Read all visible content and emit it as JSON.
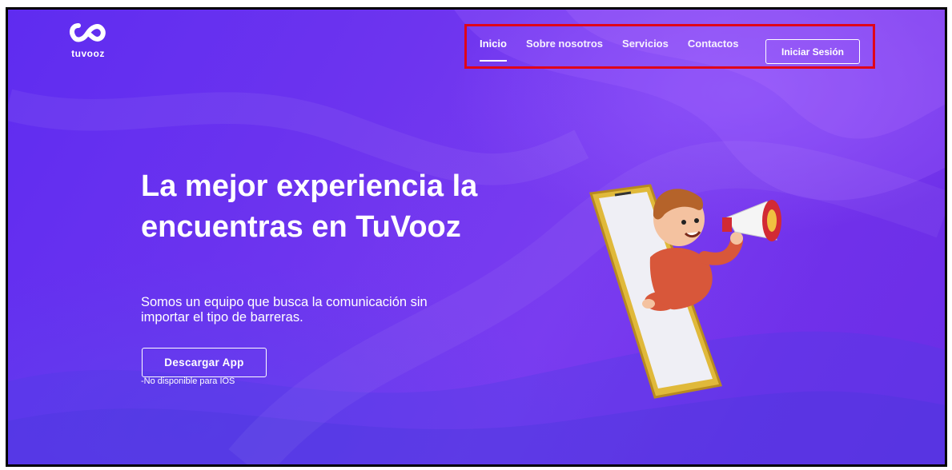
{
  "brand": {
    "name": "tuvooz",
    "logo_icon": "infinity-icon"
  },
  "nav": {
    "items": [
      {
        "label": "Inicio",
        "active": true
      },
      {
        "label": "Sobre nosotros",
        "active": false
      },
      {
        "label": "Servicios",
        "active": false
      },
      {
        "label": "Contactos",
        "active": false
      }
    ],
    "login_label": "Iniciar Sesión"
  },
  "hero": {
    "headline": "La mejor experiencia la encuentras en TuVooz",
    "subtext": "Somos un equipo que busca la comunicación sin importar el tipo de barreras.",
    "download_label": "Descargar App",
    "note": "-No disponible para IOS",
    "illustration": "boy-with-megaphone-phone-illustration"
  },
  "colors": {
    "background": "#6a30ee",
    "highlight": "#e0061a",
    "text": "#ffffff"
  }
}
